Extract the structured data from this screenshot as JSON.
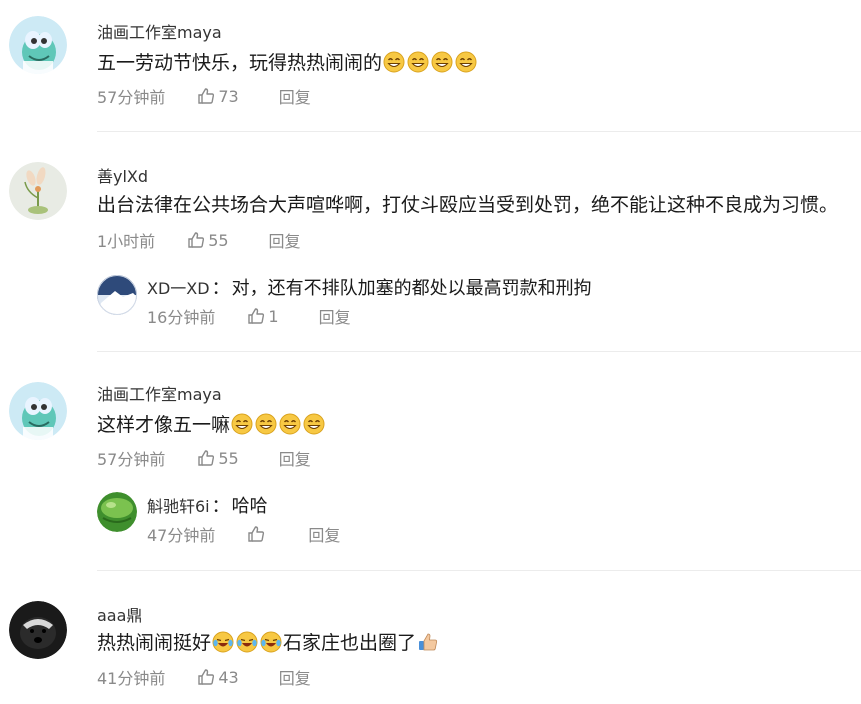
{
  "comments": [
    {
      "username": "油画工作室maya",
      "text": "五一劳动节快乐，玩得热热闹闹的",
      "emoji_count": 4,
      "emoji": "smile-emoji",
      "time": "57分钟前",
      "likes": "73",
      "reply_label": "回复"
    },
    {
      "username": "善ylXd",
      "text": "出台法律在公共场合大声喧哗啊，打仗斗殴应当受到处罚，绝不能让这种不良成为习惯。",
      "time": "1小时前",
      "likes": "55",
      "reply_label": "回复",
      "replies": [
        {
          "username": "XD一XD",
          "text": "对，还有不排队加塞的都处以最高罚款和刑拘",
          "time": "16分钟前",
          "likes": "1",
          "reply_label": "回复"
        }
      ]
    },
    {
      "username": "油画工作室maya",
      "text": "这样才像五一嘛",
      "emoji_count": 4,
      "emoji": "smile-emoji",
      "time": "57分钟前",
      "likes": "55",
      "reply_label": "回复",
      "replies": [
        {
          "username": "斛驰轩6i",
          "text": "哈哈",
          "time": "47分钟前",
          "likes": "",
          "reply_label": "回复"
        }
      ]
    },
    {
      "username": "aaa鼎",
      "text_part1": "热热闹闹挺好",
      "emoji_mid": "laugh-cry-emoji",
      "emoji_mid_count": 3,
      "text_part2": "石家庄也出圈了",
      "emoji_end": "thumbs-up-emoji",
      "time": "41分钟前",
      "likes": "43",
      "reply_label": "回复"
    }
  ],
  "colors": {
    "text": "#1a1a1a",
    "meta": "#8a8a8a",
    "divider": "#ececec",
    "emoji_yellow": "#f7c843"
  },
  "reply_separator": "："
}
